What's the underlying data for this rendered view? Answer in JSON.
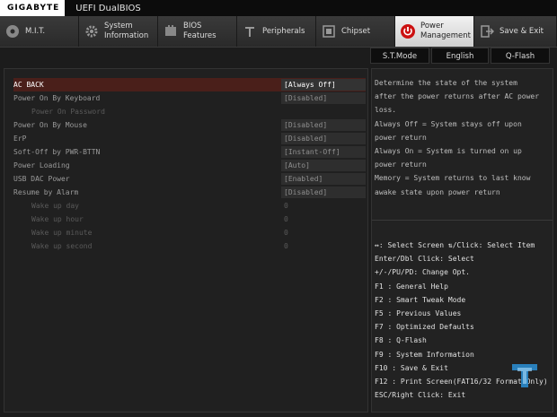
{
  "titlebar": {
    "brand": "GIGABYTE",
    "title": "UEFI DualBIOS"
  },
  "tabs": [
    {
      "label": "M.I.T.",
      "icon": "mit-disc-icon",
      "active": false
    },
    {
      "label": "System\nInformation",
      "icon": "gear-icon",
      "active": false
    },
    {
      "label": "BIOS\nFeatures",
      "icon": "bios-chip-icon",
      "active": false
    },
    {
      "label": "Peripherals",
      "icon": "peripherals-icon",
      "active": false
    },
    {
      "label": "Chipset",
      "icon": "chipset-icon",
      "active": false
    },
    {
      "label": "Power\nManagement",
      "icon": "power-icon",
      "active": true
    },
    {
      "label": "Save & Exit",
      "icon": "exit-arrow-icon",
      "active": false
    }
  ],
  "quick_buttons": {
    "st_mode": "S.T.Mode",
    "language": "English",
    "qflash": "Q-Flash"
  },
  "settings": [
    {
      "label": "AC BACK",
      "value": "[Always Off]",
      "state": "selected"
    },
    {
      "label": "Power On By Keyboard",
      "value": "[Disabled]",
      "state": "normal"
    },
    {
      "label": "Power On Password",
      "value": "",
      "state": "sub"
    },
    {
      "label": "Power On By Mouse",
      "value": "[Disabled]",
      "state": "normal"
    },
    {
      "label": "ErP",
      "value": "[Disabled]",
      "state": "normal"
    },
    {
      "label": "Soft-Off by PWR-BTTN",
      "value": "[Instant-Off]",
      "state": "normal"
    },
    {
      "label": "Power Loading",
      "value": "[Auto]",
      "state": "normal"
    },
    {
      "label": "USB DAC Power",
      "value": "[Enabled]",
      "state": "normal"
    },
    {
      "label": "Resume by Alarm",
      "value": "[Disabled]",
      "state": "normal"
    },
    {
      "label": "Wake up day",
      "value": "0",
      "state": "sub"
    },
    {
      "label": "Wake up hour",
      "value": "0",
      "state": "sub"
    },
    {
      "label": "Wake up minute",
      "value": "0",
      "state": "sub"
    },
    {
      "label": "Wake up second",
      "value": "0",
      "state": "sub"
    }
  ],
  "help": {
    "lines": [
      "Determine the state of  the system",
      "after the power returns after AC power",
      "loss.",
      "Always Off = System stays off upon",
      "power return",
      "Always On = System is turned on up",
      "power return",
      "Memory = System returns to last know",
      "awake state upon power return"
    ]
  },
  "keys": [
    "↔: Select Screen  ⇅/Click: Select Item",
    "Enter/Dbl Click: Select",
    "+/-/PU/PD: Change Opt.",
    "F1  : General Help",
    "F2  : Smart Tweak Mode",
    "F5  : Previous Values",
    "F7  : Optimized Defaults",
    "F8  : Q-Flash",
    "F9  : System Information",
    "F10 : Save & Exit",
    "F12 : Print Screen(FAT16/32 Format Only)",
    "ESC/Right Click: Exit"
  ],
  "colors": {
    "accent_red": "#cc1111",
    "selected_row": "#4a1f1a",
    "background": "#1c1c1c"
  }
}
